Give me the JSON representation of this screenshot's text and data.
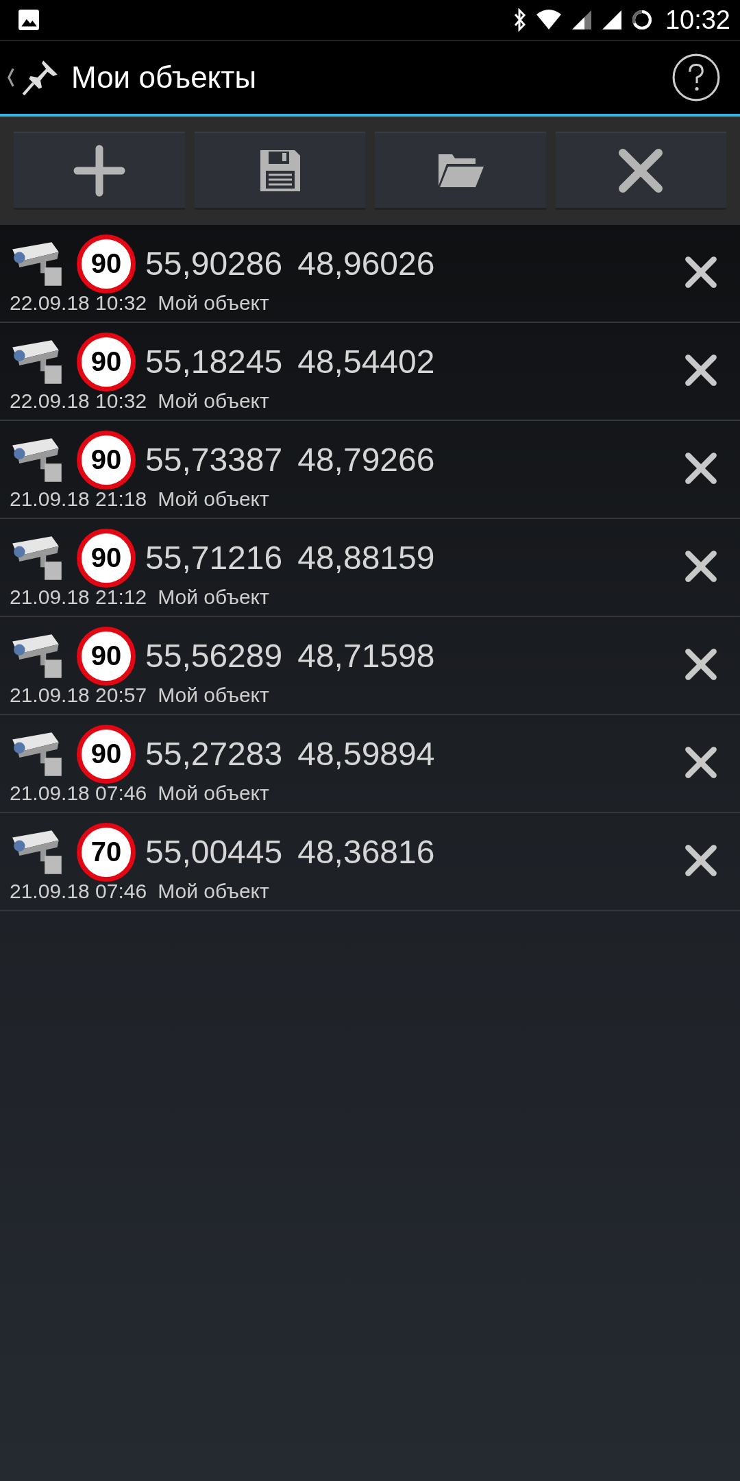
{
  "status_bar": {
    "time": "10:32"
  },
  "header": {
    "title": "Мои объекты"
  },
  "toolbar": [
    {
      "kind": "add"
    },
    {
      "kind": "save"
    },
    {
      "kind": "open"
    },
    {
      "kind": "delete"
    }
  ],
  "objects": [
    {
      "speed": "90",
      "lat": "55,90286",
      "lon": "48,96026",
      "date": "22.09.18 10:32",
      "name": "Мой объект"
    },
    {
      "speed": "90",
      "lat": "55,18245",
      "lon": "48,54402",
      "date": "22.09.18 10:32",
      "name": "Мой объект"
    },
    {
      "speed": "90",
      "lat": "55,73387",
      "lon": "48,79266",
      "date": "21.09.18 21:18",
      "name": "Мой объект"
    },
    {
      "speed": "90",
      "lat": "55,71216",
      "lon": "48,88159",
      "date": "21.09.18 21:12",
      "name": "Мой объект"
    },
    {
      "speed": "90",
      "lat": "55,56289",
      "lon": "48,71598",
      "date": "21.09.18 20:57",
      "name": "Мой объект"
    },
    {
      "speed": "90",
      "lat": "55,27283",
      "lon": "48,59894",
      "date": "21.09.18 07:46",
      "name": "Мой объект"
    },
    {
      "speed": "70",
      "lat": "55,00445",
      "lon": "48,36816",
      "date": "21.09.18 07:46",
      "name": "Мой объект"
    }
  ]
}
